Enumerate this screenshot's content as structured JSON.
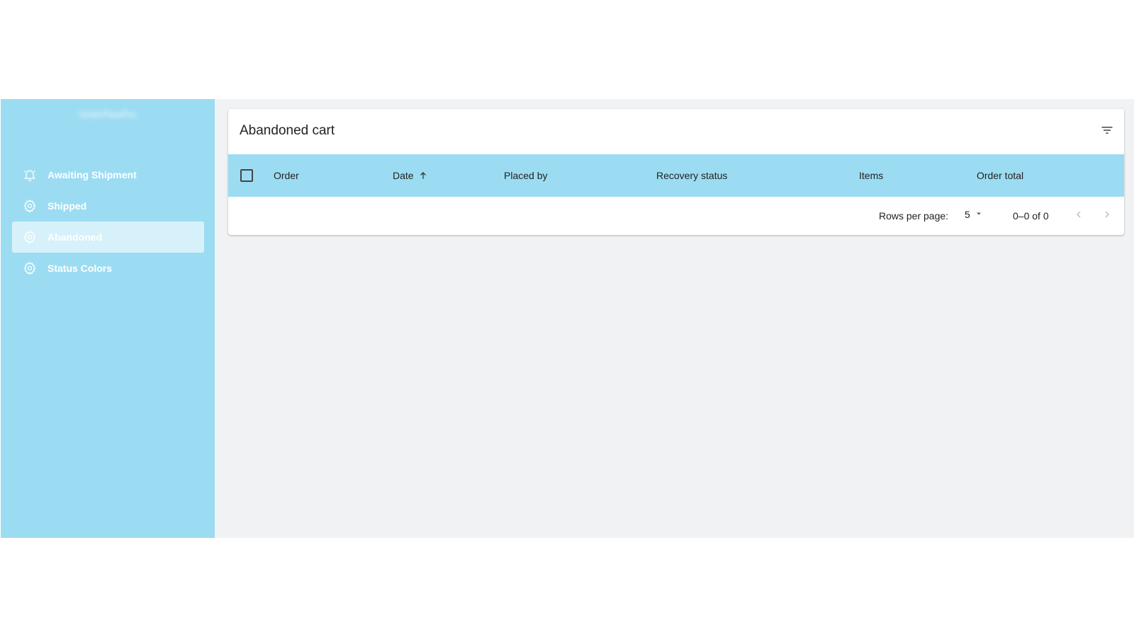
{
  "sidebar": {
    "brand": "OrderFlowPro",
    "items": [
      {
        "label": "Awaiting Shipment",
        "icon": "bell-icon"
      },
      {
        "label": "Shipped",
        "icon": "gear-icon"
      },
      {
        "label": "Abandoned",
        "icon": "gear-icon",
        "active": true
      },
      {
        "label": "Status Colors",
        "icon": "gear-icon"
      }
    ]
  },
  "card": {
    "title": "Abandoned cart",
    "filter_icon": "filter-list-icon"
  },
  "table": {
    "columns": [
      "Order",
      "Date",
      "Placed by",
      "Recovery status",
      "Items",
      "Order total"
    ],
    "sorted_column": "Date",
    "sort_direction": "ascending",
    "rows": []
  },
  "pagination": {
    "rows_per_page_label": "Rows per page:",
    "rows_per_page_value": "5",
    "range": "0–0 of 0"
  },
  "colors": {
    "accent": "#9cdcf2",
    "background": "#f1f2f4"
  }
}
